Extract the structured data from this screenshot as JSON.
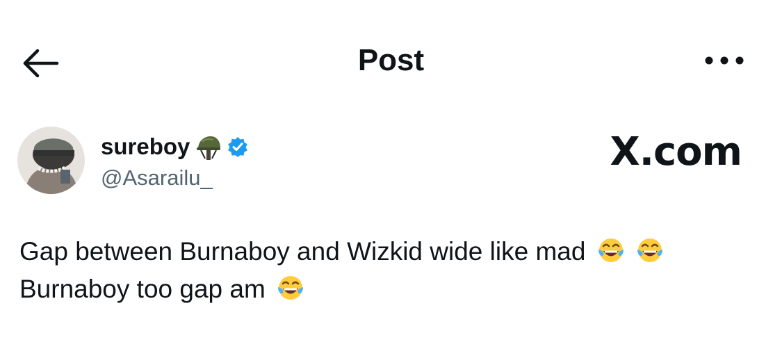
{
  "header": {
    "title": "Post",
    "back_icon": "arrow-left-icon",
    "more_icon": "more-horizontal-icon"
  },
  "author": {
    "display_name": "sureboy",
    "name_emoji": "military-helmet-icon",
    "verified_icon": "verified-badge-icon",
    "handle": "@Asarailu_"
  },
  "watermark": {
    "text": "X.com"
  },
  "post": {
    "line1": "Gap between Burnaboy and Wizkid wide like mad",
    "line2": "Burnaboy too gap am",
    "emoji": "face-with-tears-of-joy-icon"
  },
  "colors": {
    "text": "#0f1419",
    "secondary_text": "#536471",
    "verified": "#1d9bf0",
    "background": "#ffffff"
  }
}
